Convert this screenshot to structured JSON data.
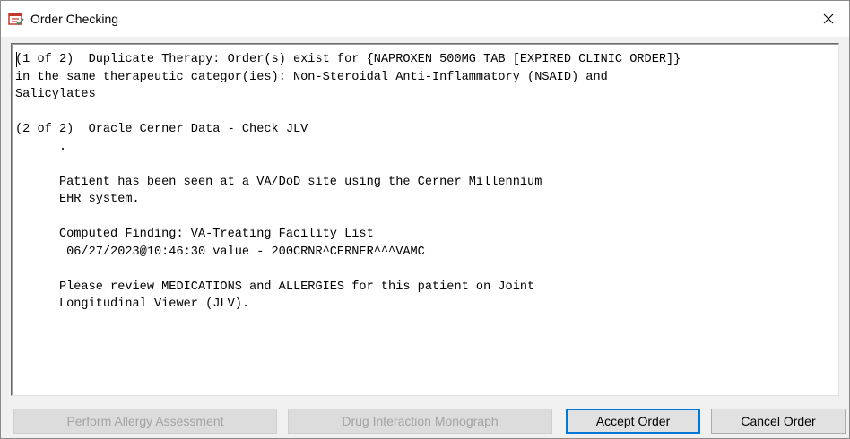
{
  "window": {
    "title": "Order Checking",
    "title_icon": "order-check-icon",
    "close_icon": "close-icon"
  },
  "memo": {
    "text": "(1 of 2)  Duplicate Therapy: Order(s) exist for {NAPROXEN 500MG TAB [EXPIRED CLINIC ORDER]}\nin the same therapeutic categor(ies): Non-Steroidal Anti-Inflammatory (NSAID) and\nSalicylates\n\n(2 of 2)  Oracle Cerner Data - Check JLV\n      .\n\n      Patient has been seen at a VA/DoD site using the Cerner Millennium\n      EHR system.\n\n      Computed Finding: VA-Treating Facility List\n       06/27/2023@10:46:30 value - 200CRNR^CERNER^^^VAMC\n\n      Please review MEDICATIONS and ALLERGIES for this patient on Joint\n      Longitudinal Viewer (JLV)."
  },
  "buttons": {
    "perform_allergy_assessment": "Perform Allergy Assessment",
    "drug_interaction_monograph": "Drug Interaction Monograph",
    "accept_order": "Accept Order",
    "cancel_order": "Cancel Order"
  },
  "colors": {
    "title_bar": "#ffffff",
    "dialog_background": "#f0f0f0",
    "focus_border": "#0078d7",
    "disabled_text": "#a3a3a3"
  }
}
